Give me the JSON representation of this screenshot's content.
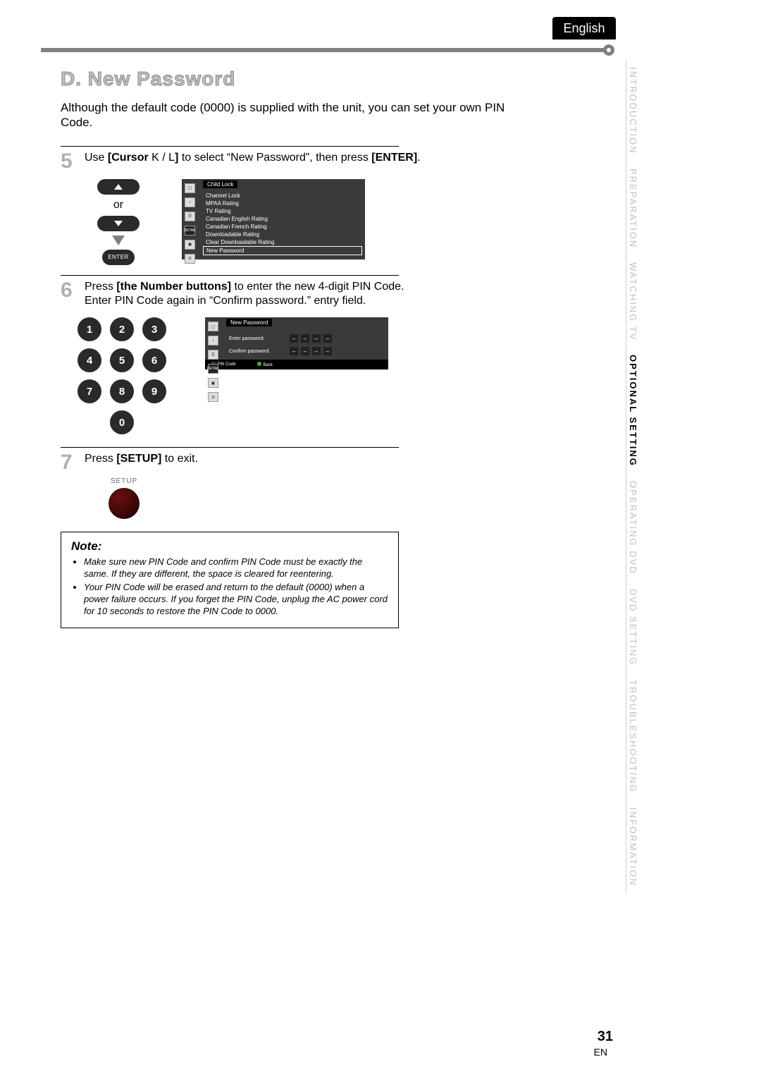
{
  "header": {
    "language_tab": "English"
  },
  "sidenav": {
    "items": [
      {
        "label": "INTRODUCTION",
        "active": false
      },
      {
        "label": "PREPARATION",
        "active": false
      },
      {
        "label": "WATCHING TV",
        "active": false
      },
      {
        "label": "OPTIONAL SETTING",
        "active": true
      },
      {
        "label": "OPERATING DVD",
        "active": false
      },
      {
        "label": "DVD SETTING",
        "active": false
      },
      {
        "label": "TROUBLESHOOTING",
        "active": false
      },
      {
        "label": "INFORMATION",
        "active": false
      }
    ]
  },
  "section": {
    "title": "D. New Password",
    "intro": "Although the default code (0000) is supplied with the unit, you can set your own PIN Code."
  },
  "steps": {
    "s5": {
      "num": "5",
      "pre": "Use ",
      "bold1": "[Cursor ",
      "mid1": "K / L",
      "bold1b": "]",
      "mid2": " to select “New Password”, then press ",
      "bold2": "[ENTER]",
      "post": "."
    },
    "s6": {
      "num": "6",
      "pre": "Press ",
      "bold1": "[the Number buttons]",
      "mid1": " to enter the new 4-digit PIN Code.",
      "line2": "Enter PIN Code again in “Confirm password.” entry field."
    },
    "s7": {
      "num": "7",
      "pre": "Press ",
      "bold1": "[SETUP]",
      "post": " to exit."
    }
  },
  "remote": {
    "or": "or",
    "enter": "ENTER",
    "setup_label": "SETUP",
    "numpad": [
      "1",
      "2",
      "3",
      "4",
      "5",
      "6",
      "7",
      "8",
      "9",
      "0"
    ]
  },
  "osd1": {
    "title": "Child Lock",
    "detail": "DETAIL",
    "items": [
      "Channel Lock",
      "MPAA Rating",
      "TV Rating",
      "Canadian English Rating",
      "Canadian French Rating",
      "Downloadable Rating",
      "Clear Downloadable Rating",
      "New Password"
    ]
  },
  "osd2": {
    "title": "New Password",
    "detail": "DETAIL",
    "row1_label": "Enter password.",
    "row2_label": "Confirm password.",
    "dash": "–",
    "footer_left": "PIN Code",
    "footer_right": "Back"
  },
  "note": {
    "title": "Note:",
    "bullets": [
      "Make sure new PIN Code and confirm PIN Code must be exactly the same. If they are different, the space is cleared for reentering.",
      "Your PIN Code will be erased and return to the default (0000) when a power failure occurs.\nIf you forget the PIN Code, unplug the AC power cord for 10 seconds to restore the PIN Code to 0000."
    ]
  },
  "footer": {
    "page_num": "31",
    "lang_code": "EN"
  }
}
